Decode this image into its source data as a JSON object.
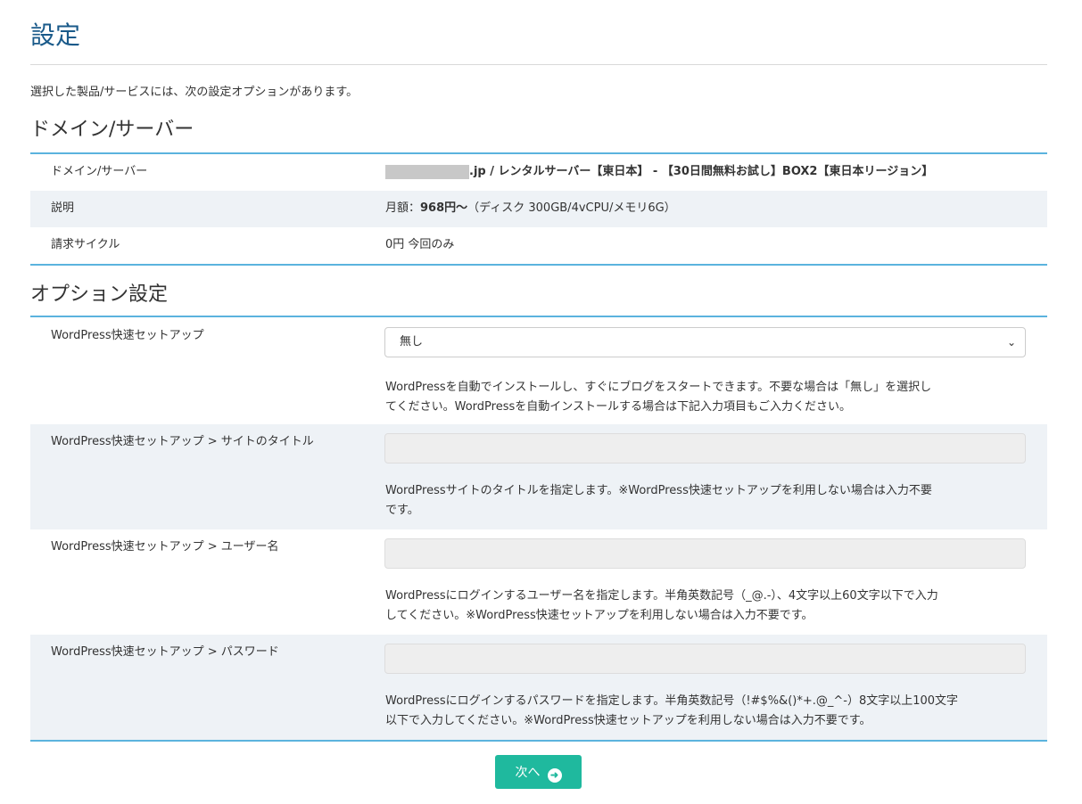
{
  "page": {
    "title": "設定",
    "intro": "選択した製品/サービスには、次の設定オプションがあります。"
  },
  "domain_section": {
    "heading": "ドメイン/サーバー",
    "rows": [
      {
        "label": "ドメイン/サーバー",
        "value_suffix": ".jp / レンタルサーバー【東日本】 - 【30日間無料お試し】BOX2【東日本リージョン】"
      },
      {
        "label": "説明",
        "value_prefix": "月額：",
        "value_bold": "968円〜",
        "value_rest": "（ディスク 300GB/4vCPU/メモリ6G）"
      },
      {
        "label": "請求サイクル",
        "value": "0円 今回のみ"
      }
    ]
  },
  "options_section": {
    "heading": "オプション設定",
    "fields": [
      {
        "label": "WordPress快速セットアップ",
        "type": "select",
        "selected": "無し",
        "help_line1": "WordPressを自動でインストールし、すぐにブログをスタートできます。不要な場合は「無し」を選択し",
        "help_line2": "てください。WordPressを自動インストールする場合は下記入力項目もご入力ください。"
      },
      {
        "label": "WordPress快速セットアップ > サイトのタイトル",
        "type": "text",
        "value": "",
        "help_line1": "WordPressサイトのタイトルを指定します。※WordPress快速セットアップを利用しない場合は入力不要",
        "help_line2": "です。"
      },
      {
        "label": "WordPress快速セットアップ > ユーザー名",
        "type": "text",
        "value": "",
        "help_line1": "WordPressにログインするユーザー名を指定します。半角英数記号（_@.-）、4文字以上60文字以下で入力",
        "help_line2": "してください。※WordPress快速セットアップを利用しない場合は入力不要です。"
      },
      {
        "label": "WordPress快速セットアップ > パスワード",
        "type": "text",
        "value": "",
        "help_line1": "WordPressにログインするパスワードを指定します。半角英数記号（!#$%&()*+.@_^-）8文字以上100文字",
        "help_line2": "以下で入力してください。※WordPress快速セットアップを利用しない場合は入力不要です。"
      }
    ]
  },
  "actions": {
    "next_label": "次へ",
    "next_icon": "arrow-circle-right-icon"
  },
  "colors": {
    "title": "#1a5a8a",
    "section_rule": "#5bb3de",
    "alt_row": "#eef2f6",
    "button": "#1fb99e"
  }
}
